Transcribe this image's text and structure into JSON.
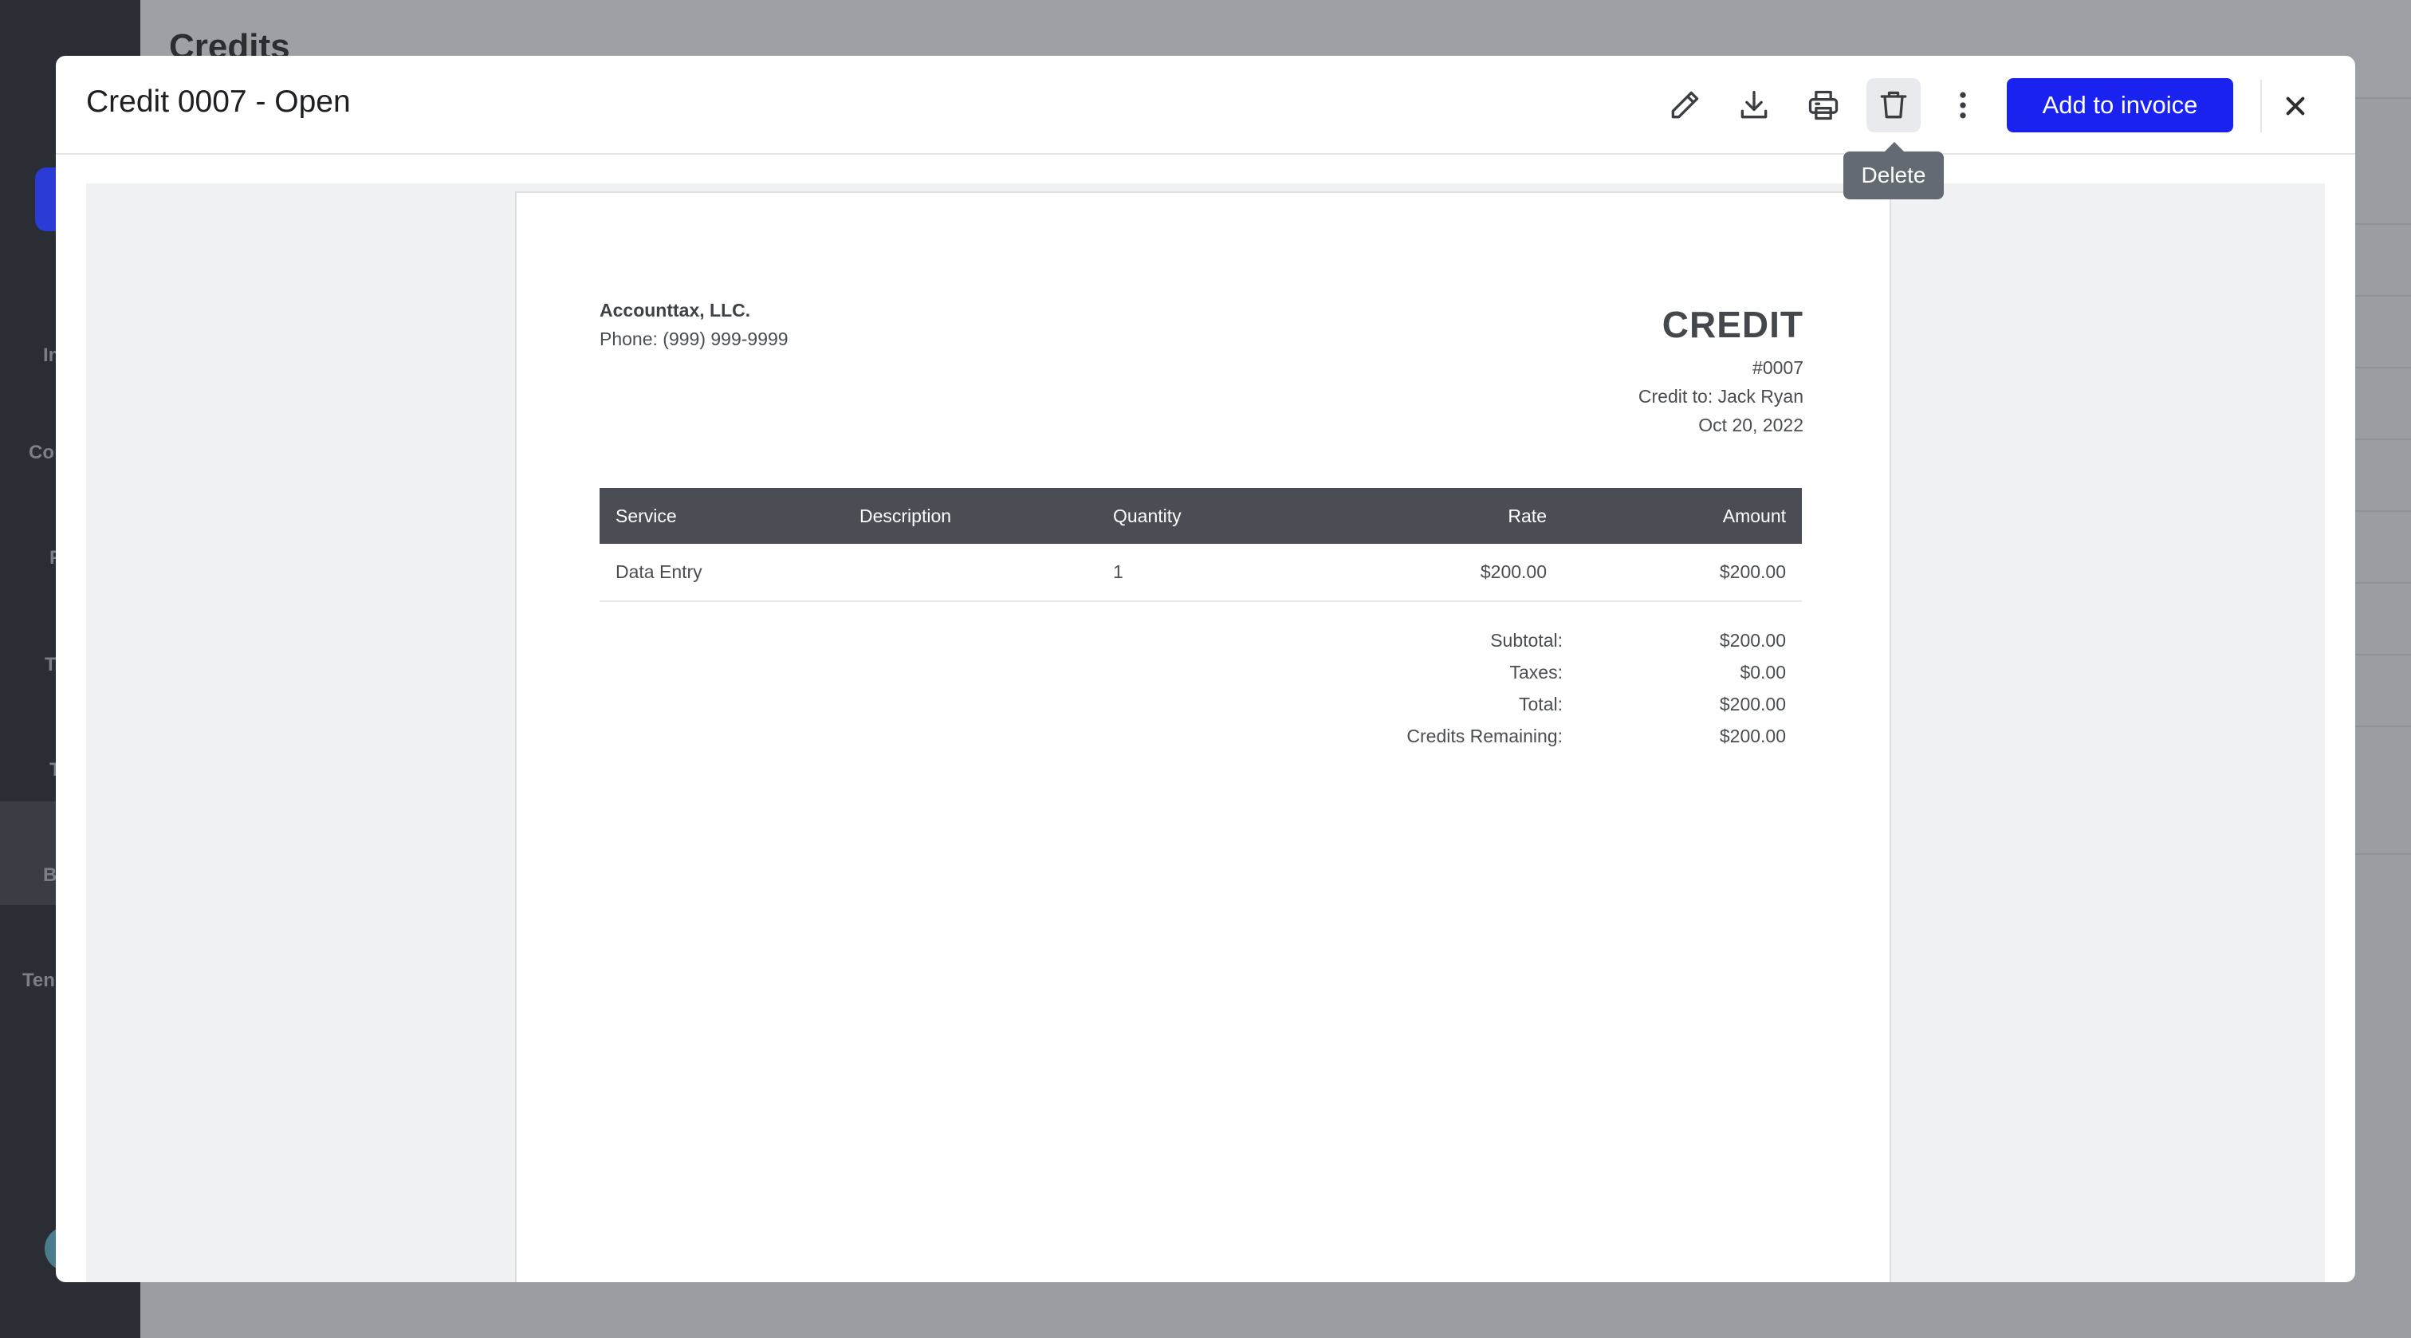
{
  "background": {
    "page_title": "Credits",
    "sidebar_fragments": [
      "In",
      "Co",
      "F",
      "T",
      "T",
      "B",
      "Ten"
    ]
  },
  "modal": {
    "title": "Credit 0007 - Open",
    "toolbar": {
      "edit_icon": "pencil-icon",
      "download_icon": "download-icon",
      "print_icon": "printer-icon",
      "delete_icon": "trash-icon",
      "more_icon": "more-vertical-icon",
      "add_to_invoice_label": "Add to invoice",
      "close_icon": "close-icon"
    },
    "tooltip": "Delete"
  },
  "document": {
    "company_name": "Accounttax, LLC.",
    "company_phone": "Phone: (999) 999-9999",
    "heading": "CREDIT",
    "number": "#0007",
    "credit_to": "Credit to: Jack Ryan",
    "date": "Oct 20, 2022",
    "columns": [
      "Service",
      "Description",
      "Quantity",
      "Rate",
      "Amount"
    ],
    "rows": [
      {
        "service": "Data Entry",
        "description": "",
        "quantity": "1",
        "rate": "$200.00",
        "amount": "$200.00"
      }
    ],
    "totals": [
      {
        "label": "Subtotal:",
        "value": "$200.00"
      },
      {
        "label": "Taxes:",
        "value": "$0.00"
      },
      {
        "label": "Total:",
        "value": "$200.00"
      },
      {
        "label": "Credits Remaining:",
        "value": "$200.00"
      }
    ]
  },
  "colors": {
    "primary": "#1a22f0",
    "table_header": "#4a4d53",
    "tooltip": "#646a72",
    "sidebar": "#2a2d33"
  }
}
